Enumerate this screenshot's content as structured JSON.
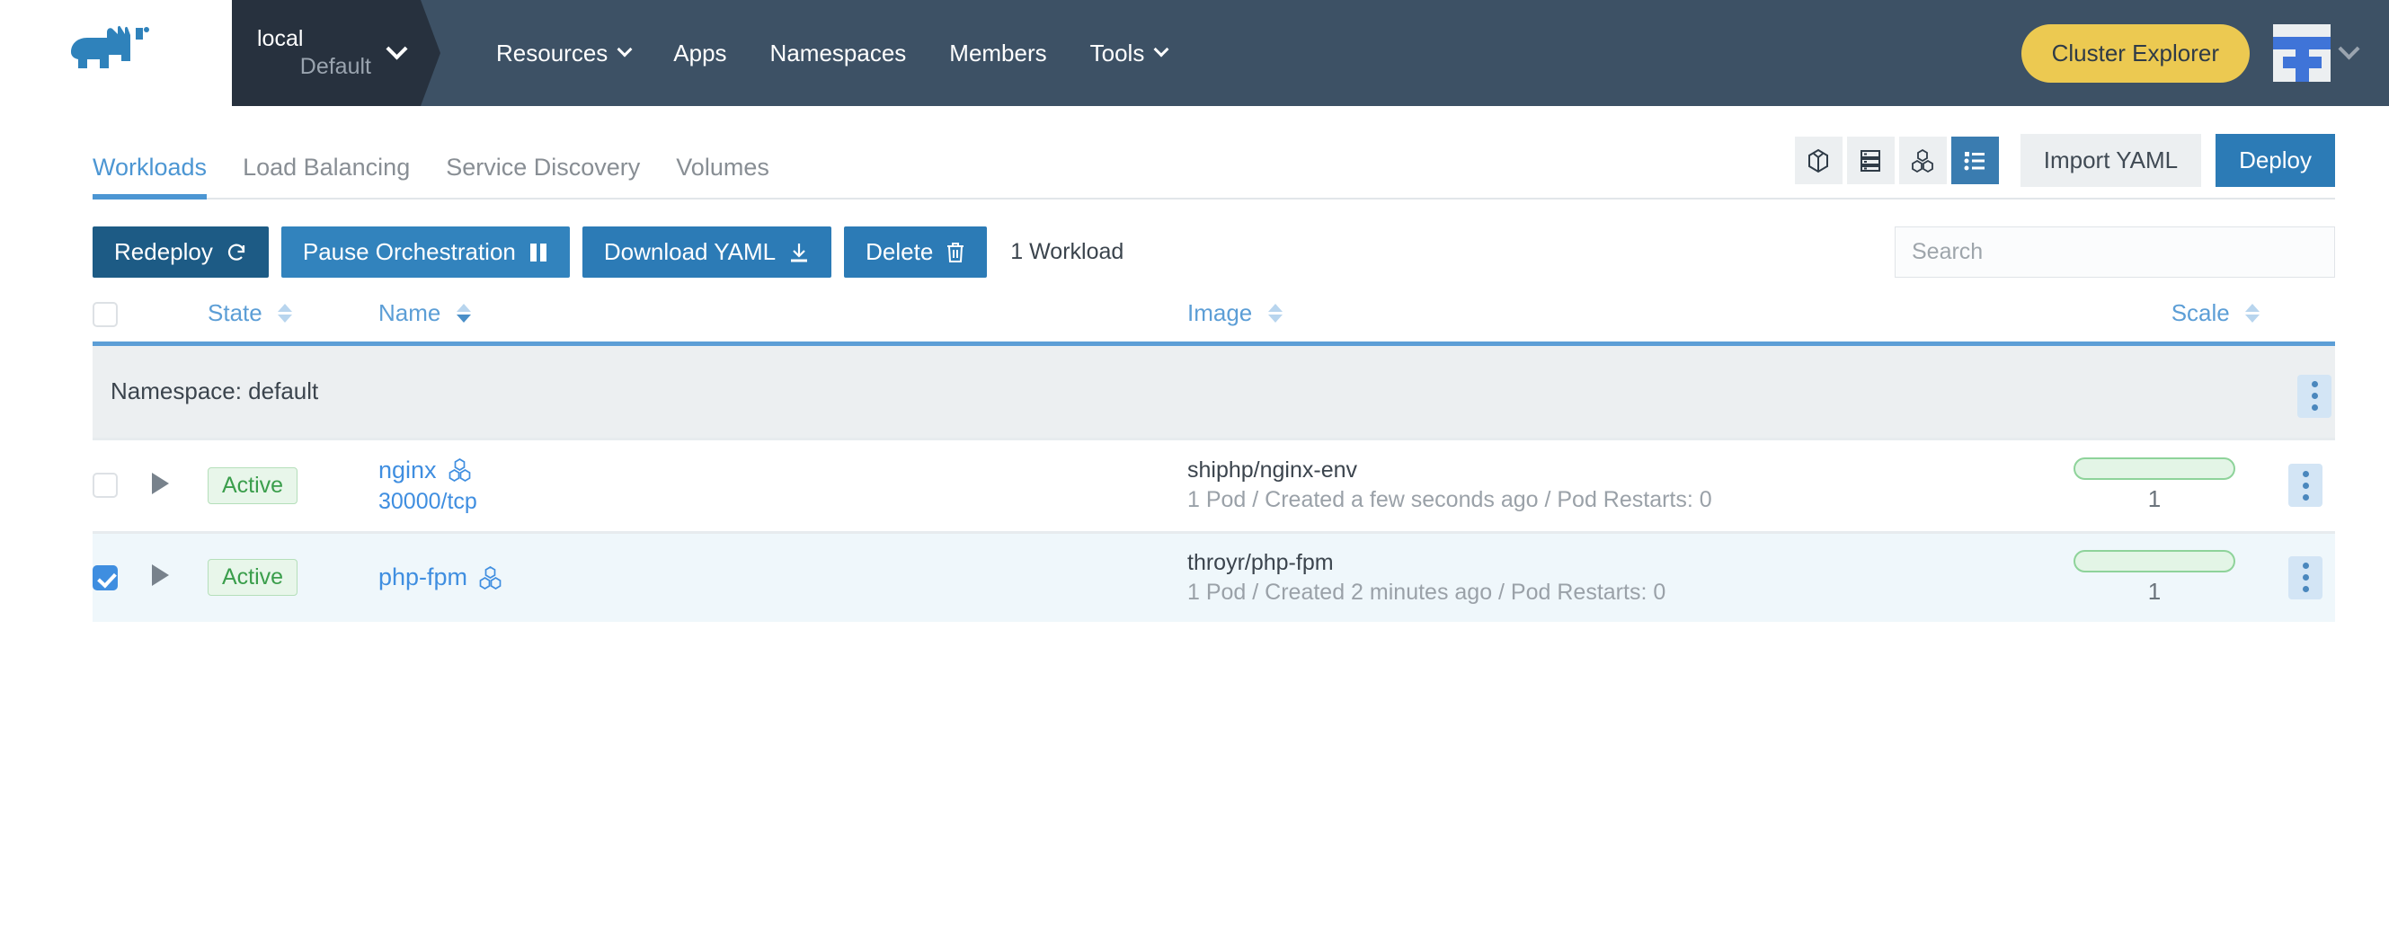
{
  "header": {
    "logo_name": "rancher-logo",
    "cluster": {
      "name": "local",
      "project": "Default"
    },
    "nav": [
      {
        "label": "Resources",
        "has_dropdown": true
      },
      {
        "label": "Apps",
        "has_dropdown": false
      },
      {
        "label": "Namespaces",
        "has_dropdown": false
      },
      {
        "label": "Members",
        "has_dropdown": false
      },
      {
        "label": "Tools",
        "has_dropdown": true
      }
    ],
    "cluster_explorer_label": "Cluster Explorer",
    "accent_yellow": "#ecc951",
    "navbar_bg": "#3d5165",
    "cluster_bg": "#27313e"
  },
  "tabs": [
    {
      "label": "Workloads",
      "active": true
    },
    {
      "label": "Load Balancing",
      "active": false
    },
    {
      "label": "Service Discovery",
      "active": false
    },
    {
      "label": "Volumes",
      "active": false
    }
  ],
  "view_toggles": [
    {
      "icon": "cube-icon",
      "active": false
    },
    {
      "icon": "server-stack-icon",
      "active": false
    },
    {
      "icon": "cluster-nodes-icon",
      "active": false
    },
    {
      "icon": "list-view-icon",
      "active": true
    }
  ],
  "toolbar": {
    "import_yaml_label": "Import YAML",
    "deploy_label": "Deploy"
  },
  "action_bar": {
    "redeploy_label": "Redeploy",
    "pause_label": "Pause Orchestration",
    "download_yaml_label": "Download YAML",
    "delete_label": "Delete",
    "workload_count": "1 Workload"
  },
  "search": {
    "placeholder": "Search",
    "value": ""
  },
  "table": {
    "columns": [
      {
        "label": "State",
        "sortable": true,
        "sorted": false
      },
      {
        "label": "Name",
        "sortable": true,
        "sorted": true
      },
      {
        "label": "Image",
        "sortable": true,
        "sorted": false
      },
      {
        "label": "Scale",
        "sortable": true,
        "sorted": false
      }
    ],
    "group_label": "Namespace: default",
    "rows": [
      {
        "selected": false,
        "state": "Active",
        "name": "nginx",
        "name_icon": "workload-icon",
        "port": "30000/tcp",
        "image": "shiphp/nginx-env",
        "image_detail": "1 Pod / Created a few seconds ago / Pod Restarts: 0",
        "scale": "1"
      },
      {
        "selected": true,
        "state": "Active",
        "name": "php-fpm",
        "name_icon": "workload-icon",
        "port": "",
        "image": "throyr/php-fpm",
        "image_detail": "1 Pod / Created 2 minutes ago / Pod Restarts: 0",
        "scale": "1"
      }
    ]
  }
}
